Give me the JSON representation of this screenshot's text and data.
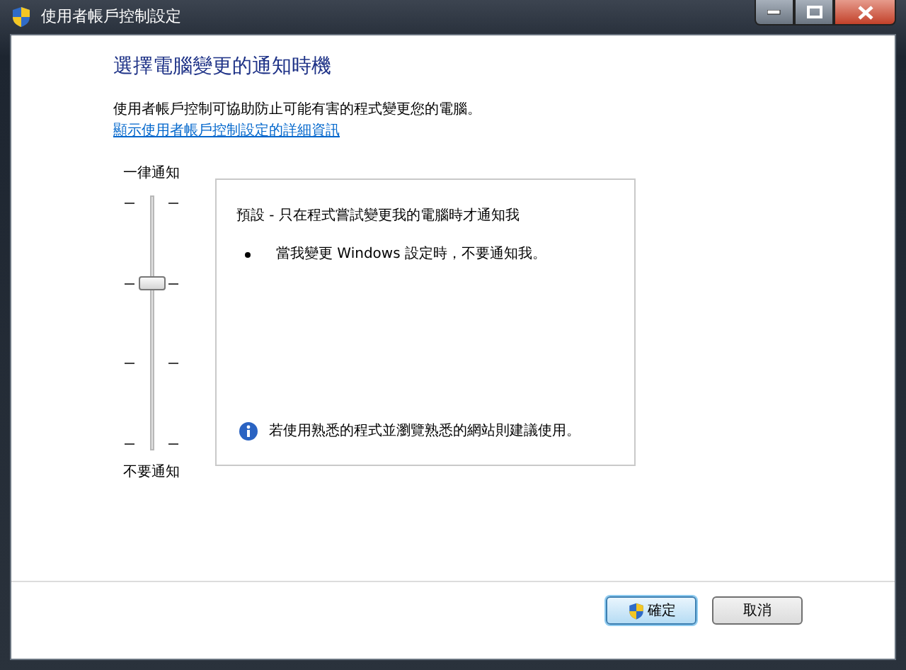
{
  "window": {
    "title": "使用者帳戶控制設定"
  },
  "heading": "選擇電腦變更的通知時機",
  "description": "使用者帳戶控制可協助防止可能有害的程式變更您的電腦。",
  "details_link": "顯示使用者帳戶控制設定的詳細資訊",
  "slider": {
    "top_label": "一律通知",
    "bottom_label": "不要通知",
    "level": 0.667
  },
  "info_panel": {
    "title": "預設 - 只在程式嘗試變更我的電腦時才通知我",
    "bullets": [
      "當我變更 Windows 設定時，不要通知我。"
    ],
    "recommendation": "若使用熟悉的程式並瀏覽熟悉的網站則建議使用。"
  },
  "buttons": [
    {
      "label": "確定",
      "kind": "shield",
      "default": true
    },
    {
      "label": "取消",
      "kind": "plain",
      "default": false
    }
  ]
}
